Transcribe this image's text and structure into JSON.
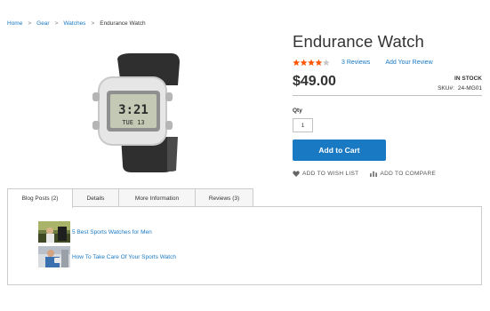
{
  "breadcrumbs": {
    "items": [
      {
        "label": "Home"
      },
      {
        "label": "Gear"
      },
      {
        "label": "Watches"
      }
    ],
    "current": "Endurance Watch",
    "separator": ">"
  },
  "product": {
    "title": "Endurance Watch",
    "rating_fraction": 0.8,
    "reviews_count": "3",
    "reviews_label": "Reviews",
    "add_review_label": "Add Your Review",
    "price": "$49.00",
    "stock_status": "In stock",
    "sku_label": "SKU#:",
    "sku": "24-MG01",
    "qty_label": "Qty",
    "qty_value": "1",
    "add_to_cart_label": "Add to Cart",
    "wishlist_label": "Add to Wish List",
    "compare_label": "Add to Compare",
    "image": {
      "screen_top": "3:21",
      "screen_bottom": "TUE 13"
    }
  },
  "tabs": [
    {
      "label": "Blog Posts (2)",
      "active": true
    },
    {
      "label": "Details",
      "active": false
    },
    {
      "label": "More Information",
      "active": false
    },
    {
      "label": "Reviews (3)",
      "active": false
    }
  ],
  "blog_posts": [
    {
      "title": "5 Best Sports Watches for Men"
    },
    {
      "title": "How To Take Care Of Your Sports Watch"
    }
  ],
  "colors": {
    "link": "#1979c3",
    "button": "#1979c3",
    "star": "#ff5501",
    "star_empty": "#c7c7c7",
    "text": "#333333",
    "tab_bg": "#f6f6f6",
    "border": "#cccccc"
  },
  "icons": {
    "wishlist": "heart-icon",
    "compare": "bar-chart-icon"
  }
}
